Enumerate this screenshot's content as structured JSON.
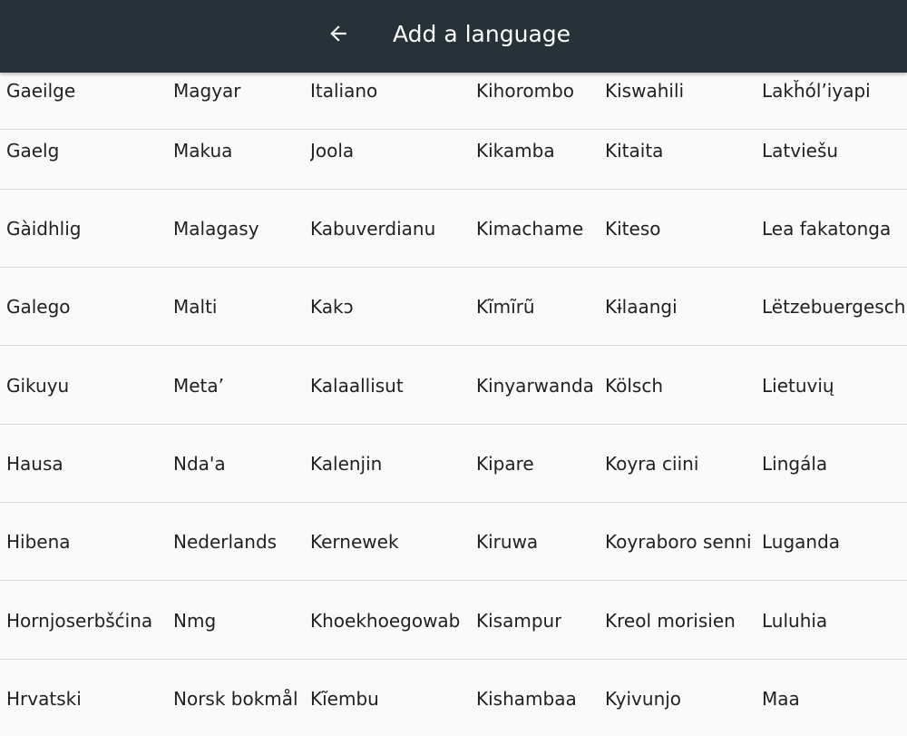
{
  "header": {
    "title": "Add a language",
    "back_icon": "arrow-left-icon"
  },
  "languages": [
    [
      "Gaeilge",
      "Magyar",
      "Italiano",
      "Kihorombo",
      "Kiswahili",
      "Lakȟól’iyapi"
    ],
    [
      "Gaelg",
      "Makua",
      "Joola",
      "Kikamba",
      "Kitaita",
      "Latviešu"
    ],
    [
      "Gàidhlig",
      "Malagasy",
      "Kabuverdianu",
      "Kimachame",
      "Kiteso",
      "Lea fakatonga"
    ],
    [
      "Galego",
      "Malti",
      "Kakɔ",
      "Kĩmĩrũ",
      "Kɨlaangi",
      "Lëtzebuergesch"
    ],
    [
      "Gikuyu",
      "Meta’",
      "Kalaallisut",
      "Kinyarwanda",
      "Kölsch",
      "Lietuvių"
    ],
    [
      "Hausa",
      "Ndaꞌa",
      "Kalenjin",
      "Kipare",
      "Koyra ciini",
      "Lingála"
    ],
    [
      "Hibena",
      "Nederlands",
      "Kernewek",
      "Kiruwa",
      "Koyraboro senni",
      "Luganda"
    ],
    [
      "Hornjoserbšćina",
      "Nmg",
      "Khoekhoegowab",
      "Kisampur",
      "Kreol morisien",
      "Luluhia"
    ],
    [
      "Hrvatski",
      "Norsk bokmål",
      "Kĩembu",
      "Kishambaa",
      "Kyivunjo",
      "Maa"
    ]
  ]
}
